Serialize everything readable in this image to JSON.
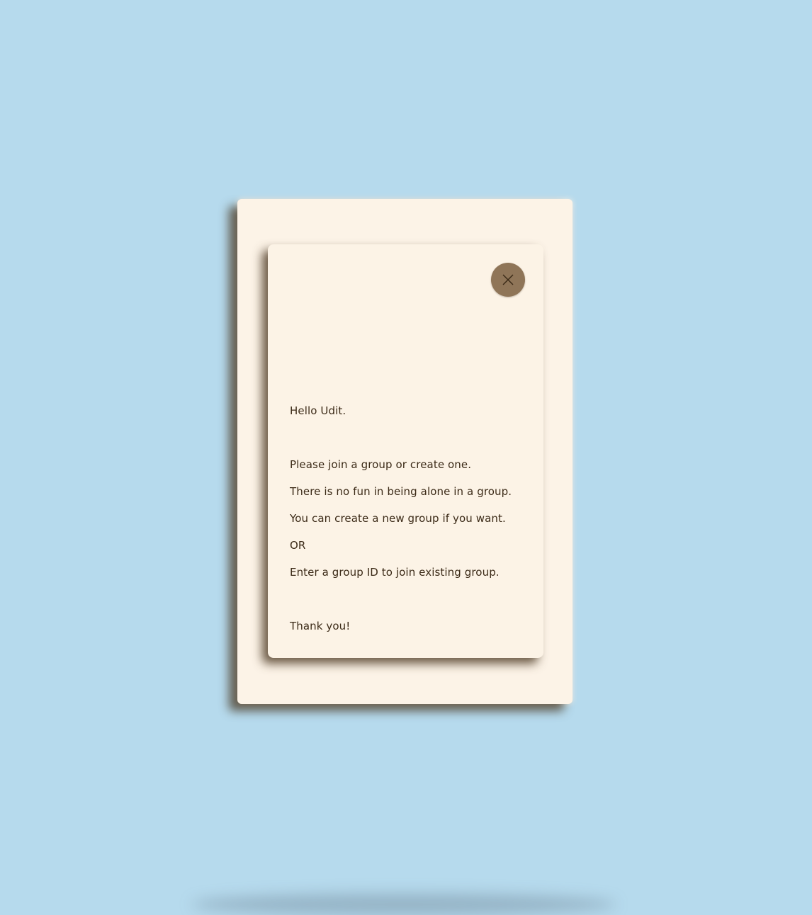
{
  "dialog": {
    "close_icon": "close-icon",
    "greeting": "Hello Udit.",
    "lines": [
      "Please join a group or create one.",
      "There is no fun in being alone in a group.",
      "You can create a new group if you want.",
      "OR",
      "Enter a group ID to join existing group."
    ],
    "signoff": "Thank you!"
  },
  "colors": {
    "background": "#b6daed",
    "card": "#fcf3e7",
    "close_button": "#8f7558",
    "text": "#3b2a17"
  }
}
